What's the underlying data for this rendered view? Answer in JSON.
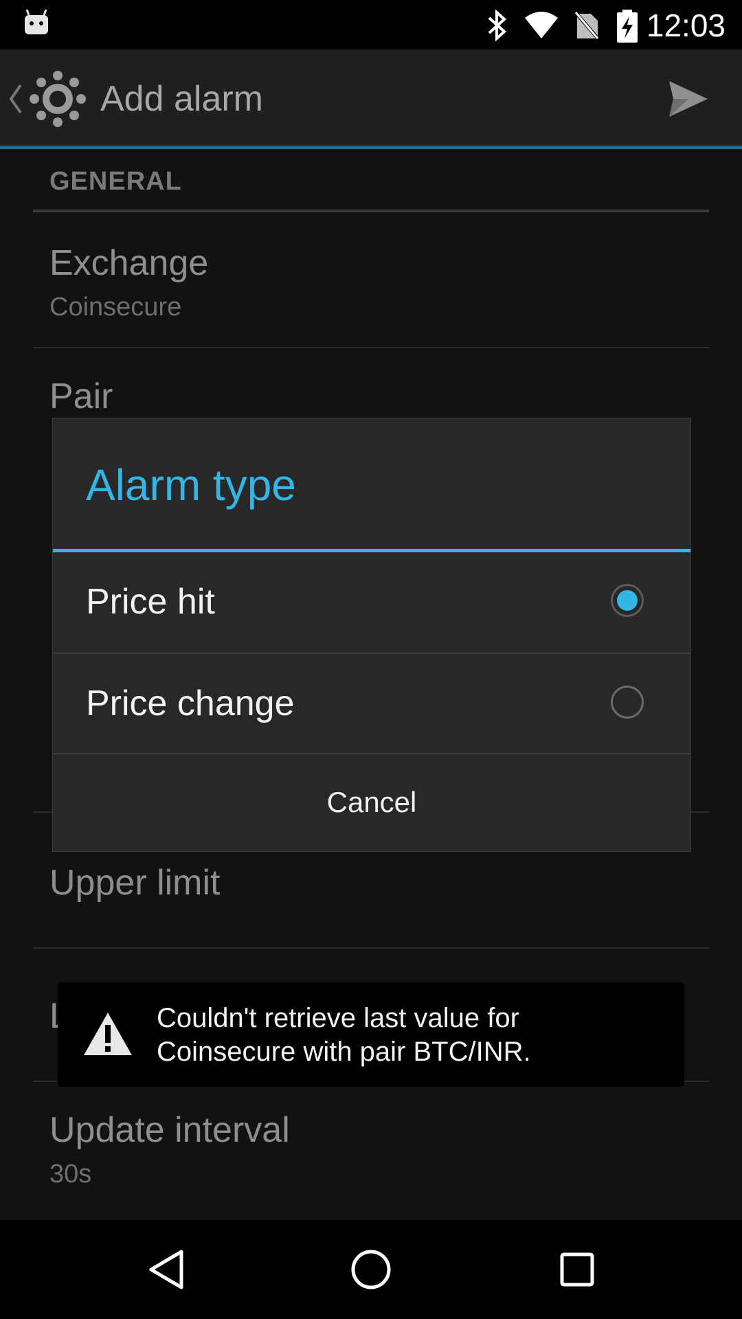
{
  "status_bar": {
    "time": "12:03",
    "icons": [
      "android-notification-icon",
      "bluetooth-icon",
      "wifi-icon",
      "no-sim-icon",
      "battery-charging-icon"
    ]
  },
  "action_bar": {
    "title": "Add alarm",
    "icons": [
      "up-chevron-icon",
      "app-logo-icon",
      "send-icon"
    ]
  },
  "preferences": {
    "category_general": "GENERAL",
    "exchange_title": "Exchange",
    "exchange_value": "Coinsecure",
    "pair_title": "Pair",
    "upper_limit_title": "Upper limit",
    "lower_limit_partial": "L",
    "update_interval_title": "Update interval",
    "update_interval_value": "30s"
  },
  "dialog": {
    "title": "Alarm type",
    "options": [
      {
        "label": "Price hit",
        "selected": true
      },
      {
        "label": "Price change",
        "selected": false
      }
    ],
    "cancel_label": "Cancel"
  },
  "toast": {
    "message": "Couldn't retrieve last value for Coinsecure with pair BTC/INR.",
    "icon": "warning-icon"
  },
  "nav_bar": {
    "icons": [
      "back-icon",
      "home-icon",
      "recents-icon"
    ]
  },
  "colors": {
    "accent": "#33b5e5",
    "action_bar_line": "#1e6f8f",
    "background": "#121212",
    "dialog_bg": "#282828"
  }
}
